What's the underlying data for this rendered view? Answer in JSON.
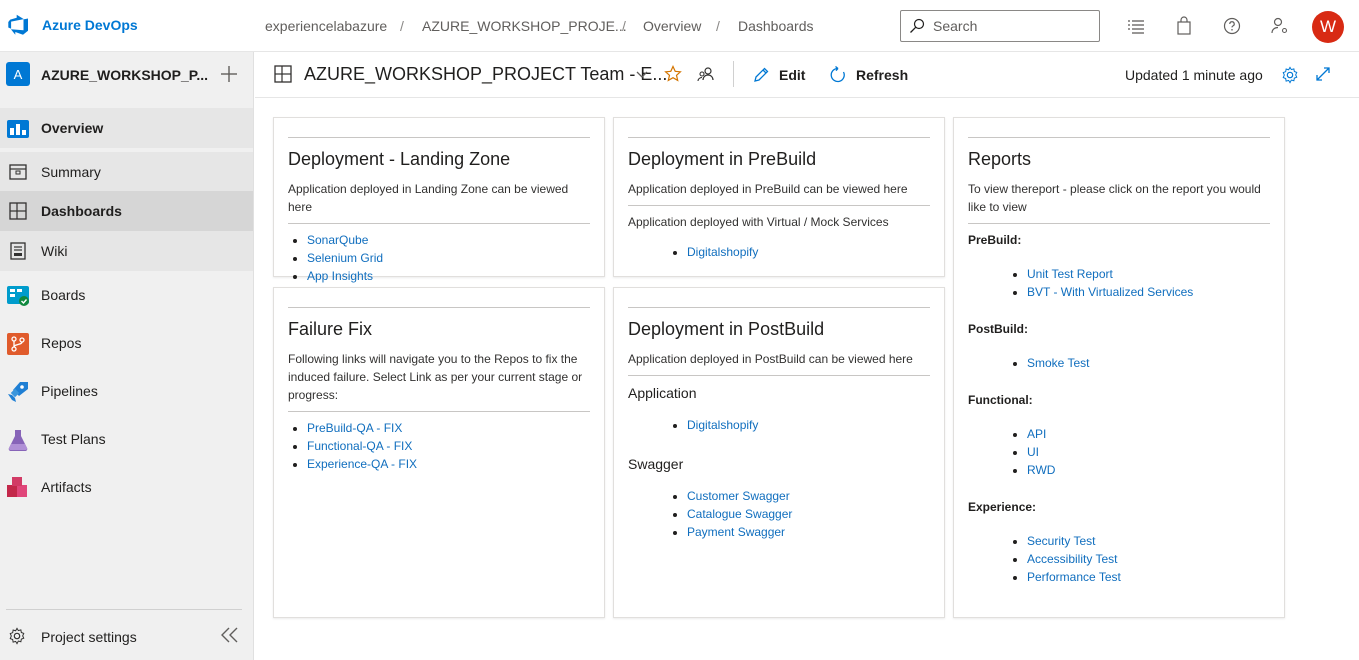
{
  "app": {
    "name": "Azure DevOps"
  },
  "breadcrumb": [
    "experiencelabazure",
    "AZURE_WORKSHOP_PROJE...",
    "Overview",
    "Dashboards"
  ],
  "search": {
    "placeholder": "Search"
  },
  "user": {
    "initial": "W",
    "avatar_color": "#d82a13"
  },
  "project": {
    "badge": "A",
    "name": "AZURE_WORKSHOP_P..."
  },
  "sidebar": {
    "items": [
      {
        "label": "Overview",
        "icon": "overview-icon"
      },
      {
        "label": "Summary",
        "icon": "summary-icon"
      },
      {
        "label": "Dashboards",
        "icon": "dashboards-icon"
      },
      {
        "label": "Wiki",
        "icon": "wiki-icon"
      },
      {
        "label": "Boards",
        "icon": "boards-icon"
      },
      {
        "label": "Repos",
        "icon": "repos-icon"
      },
      {
        "label": "Pipelines",
        "icon": "pipelines-icon"
      },
      {
        "label": "Test Plans",
        "icon": "test-plans-icon"
      },
      {
        "label": "Artifacts",
        "icon": "artifacts-icon"
      }
    ],
    "settings_label": "Project settings"
  },
  "header": {
    "title": "AZURE_WORKSHOP_PROJECT Team - E...",
    "edit_label": "Edit",
    "refresh_label": "Refresh",
    "updated": "Updated 1 minute ago"
  },
  "widgets": {
    "landing": {
      "title": "Deployment - Landing Zone",
      "desc": "Application deployed in Landing Zone can be viewed here",
      "links": [
        "SonarQube",
        "Selenium Grid",
        "App Insights"
      ]
    },
    "prebuild": {
      "title": "Deployment in PreBuild",
      "desc": "Application deployed in PreBuild can be viewed here",
      "desc2": "Application deployed with Virtual / Mock Services",
      "links": [
        "Digitalshopify"
      ]
    },
    "failure": {
      "title": "Failure Fix",
      "desc": "Following links will navigate you to the Repos to fix the induced failure. Select Link as per your current stage or progress:",
      "links": [
        "PreBuild-QA - FIX",
        "Functional-QA - FIX",
        "Experience-QA - FIX"
      ]
    },
    "postbuild": {
      "title": "Deployment in PostBuild",
      "desc": "Application deployed in PostBuild can be viewed here",
      "app_heading": "Application",
      "app_links": [
        "Digitalshopify"
      ],
      "swagger_heading": "Swagger",
      "swagger_links": [
        "Customer Swagger",
        "Catalogue Swagger",
        "Payment Swagger"
      ]
    },
    "reports": {
      "title": "Reports",
      "desc": "To view thereport - please click on the report you would like to view",
      "sections": [
        {
          "label": "PreBuild:",
          "links": [
            "Unit Test Report",
            "BVT - With Virtualized Services"
          ]
        },
        {
          "label": "PostBuild:",
          "links": [
            "Smoke Test"
          ]
        },
        {
          "label": "Functional:",
          "links": [
            "API",
            "UI",
            "RWD"
          ]
        },
        {
          "label": "Experience:",
          "links": [
            "Security Test",
            "Accessibility Test",
            "Performance Test"
          ]
        }
      ]
    }
  },
  "colors": {
    "accent": "#0078d4",
    "link": "#106ebe",
    "star": "#d47500"
  }
}
